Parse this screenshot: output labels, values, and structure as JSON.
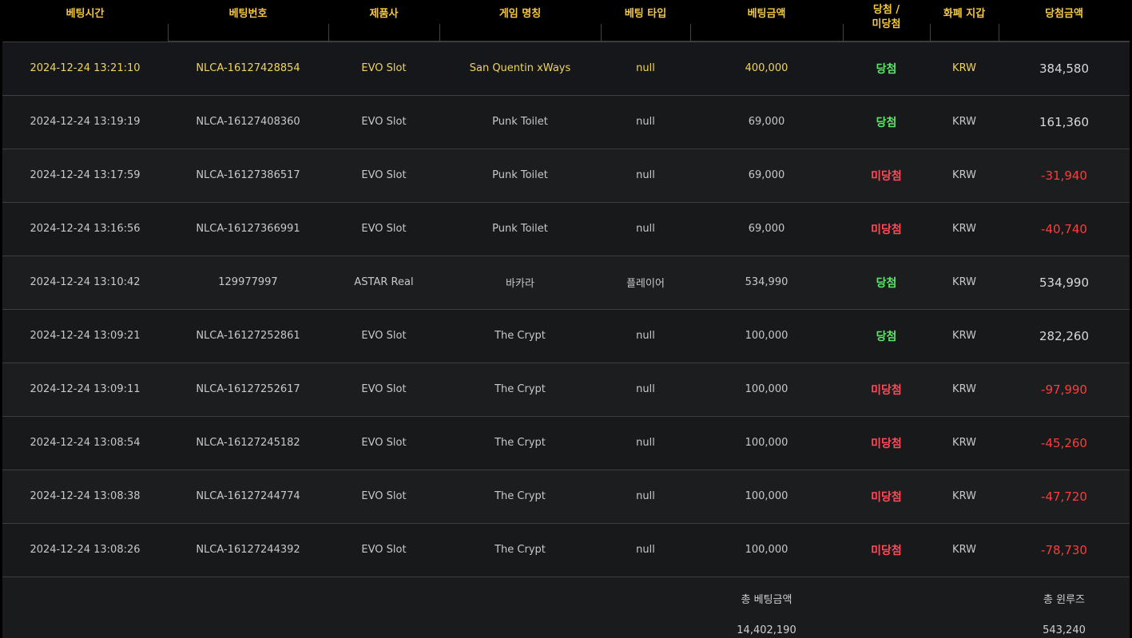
{
  "headers": {
    "bet_time": "베팅시간",
    "bet_no": "베팅번호",
    "provider": "제품사",
    "game_name": "게임 명칭",
    "bet_type": "베팅 타입",
    "bet_amount": "베팅금액",
    "result_line1": "당첨 /",
    "result_line2": "미당첨",
    "currency": "화폐 지갑",
    "win_amount": "당첨금액"
  },
  "rows": [
    {
      "time": "2024-12-24 13:21:10",
      "bet_no": "NLCA-16127428854",
      "provider": "EVO Slot",
      "game": "San Quentin xWays",
      "type": "null",
      "amount": "400,000",
      "result": "당첨",
      "currency": "KRW",
      "win": "384,580"
    },
    {
      "time": "2024-12-24 13:19:19",
      "bet_no": "NLCA-16127408360",
      "provider": "EVO Slot",
      "game": "Punk Toilet",
      "type": "null",
      "amount": "69,000",
      "result": "당첨",
      "currency": "KRW",
      "win": "161,360"
    },
    {
      "time": "2024-12-24 13:17:59",
      "bet_no": "NLCA-16127386517",
      "provider": "EVO Slot",
      "game": "Punk Toilet",
      "type": "null",
      "amount": "69,000",
      "result": "미당첨",
      "currency": "KRW",
      "win": "-31,940"
    },
    {
      "time": "2024-12-24 13:16:56",
      "bet_no": "NLCA-16127366991",
      "provider": "EVO Slot",
      "game": "Punk Toilet",
      "type": "null",
      "amount": "69,000",
      "result": "미당첨",
      "currency": "KRW",
      "win": "-40,740"
    },
    {
      "time": "2024-12-24 13:10:42",
      "bet_no": "129977997",
      "provider": "ASTAR Real",
      "game": "바카라",
      "type": "플레이어",
      "amount": "534,990",
      "result": "당첨",
      "currency": "KRW",
      "win": "534,990"
    },
    {
      "time": "2024-12-24 13:09:21",
      "bet_no": "NLCA-16127252861",
      "provider": "EVO Slot",
      "game": "The Crypt",
      "type": "null",
      "amount": "100,000",
      "result": "당첨",
      "currency": "KRW",
      "win": "282,260"
    },
    {
      "time": "2024-12-24 13:09:11",
      "bet_no": "NLCA-16127252617",
      "provider": "EVO Slot",
      "game": "The Crypt",
      "type": "null",
      "amount": "100,000",
      "result": "미당첨",
      "currency": "KRW",
      "win": "-97,990"
    },
    {
      "time": "2024-12-24 13:08:54",
      "bet_no": "NLCA-16127245182",
      "provider": "EVO Slot",
      "game": "The Crypt",
      "type": "null",
      "amount": "100,000",
      "result": "미당첨",
      "currency": "KRW",
      "win": "-45,260"
    },
    {
      "time": "2024-12-24 13:08:38",
      "bet_no": "NLCA-16127244774",
      "provider": "EVO Slot",
      "game": "The Crypt",
      "type": "null",
      "amount": "100,000",
      "result": "미당첨",
      "currency": "KRW",
      "win": "-47,720"
    },
    {
      "time": "2024-12-24 13:08:26",
      "bet_no": "NLCA-16127244392",
      "provider": "EVO Slot",
      "game": "The Crypt",
      "type": "null",
      "amount": "100,000",
      "result": "미당첨",
      "currency": "KRW",
      "win": "-78,730"
    }
  ],
  "totals": {
    "bet_label": "총 베팅금액",
    "bet_value": "14,402,190",
    "winlose_label": "총 윈루즈",
    "winlose_value": "543,240"
  },
  "colors": {
    "header_text": "#f5c842",
    "win": "#5ee36b",
    "lose": "#ff4a5a",
    "negative_amount": "#ff3b3b",
    "highlight_row_text": "#f0d45a",
    "background": "#1a1b1d"
  }
}
